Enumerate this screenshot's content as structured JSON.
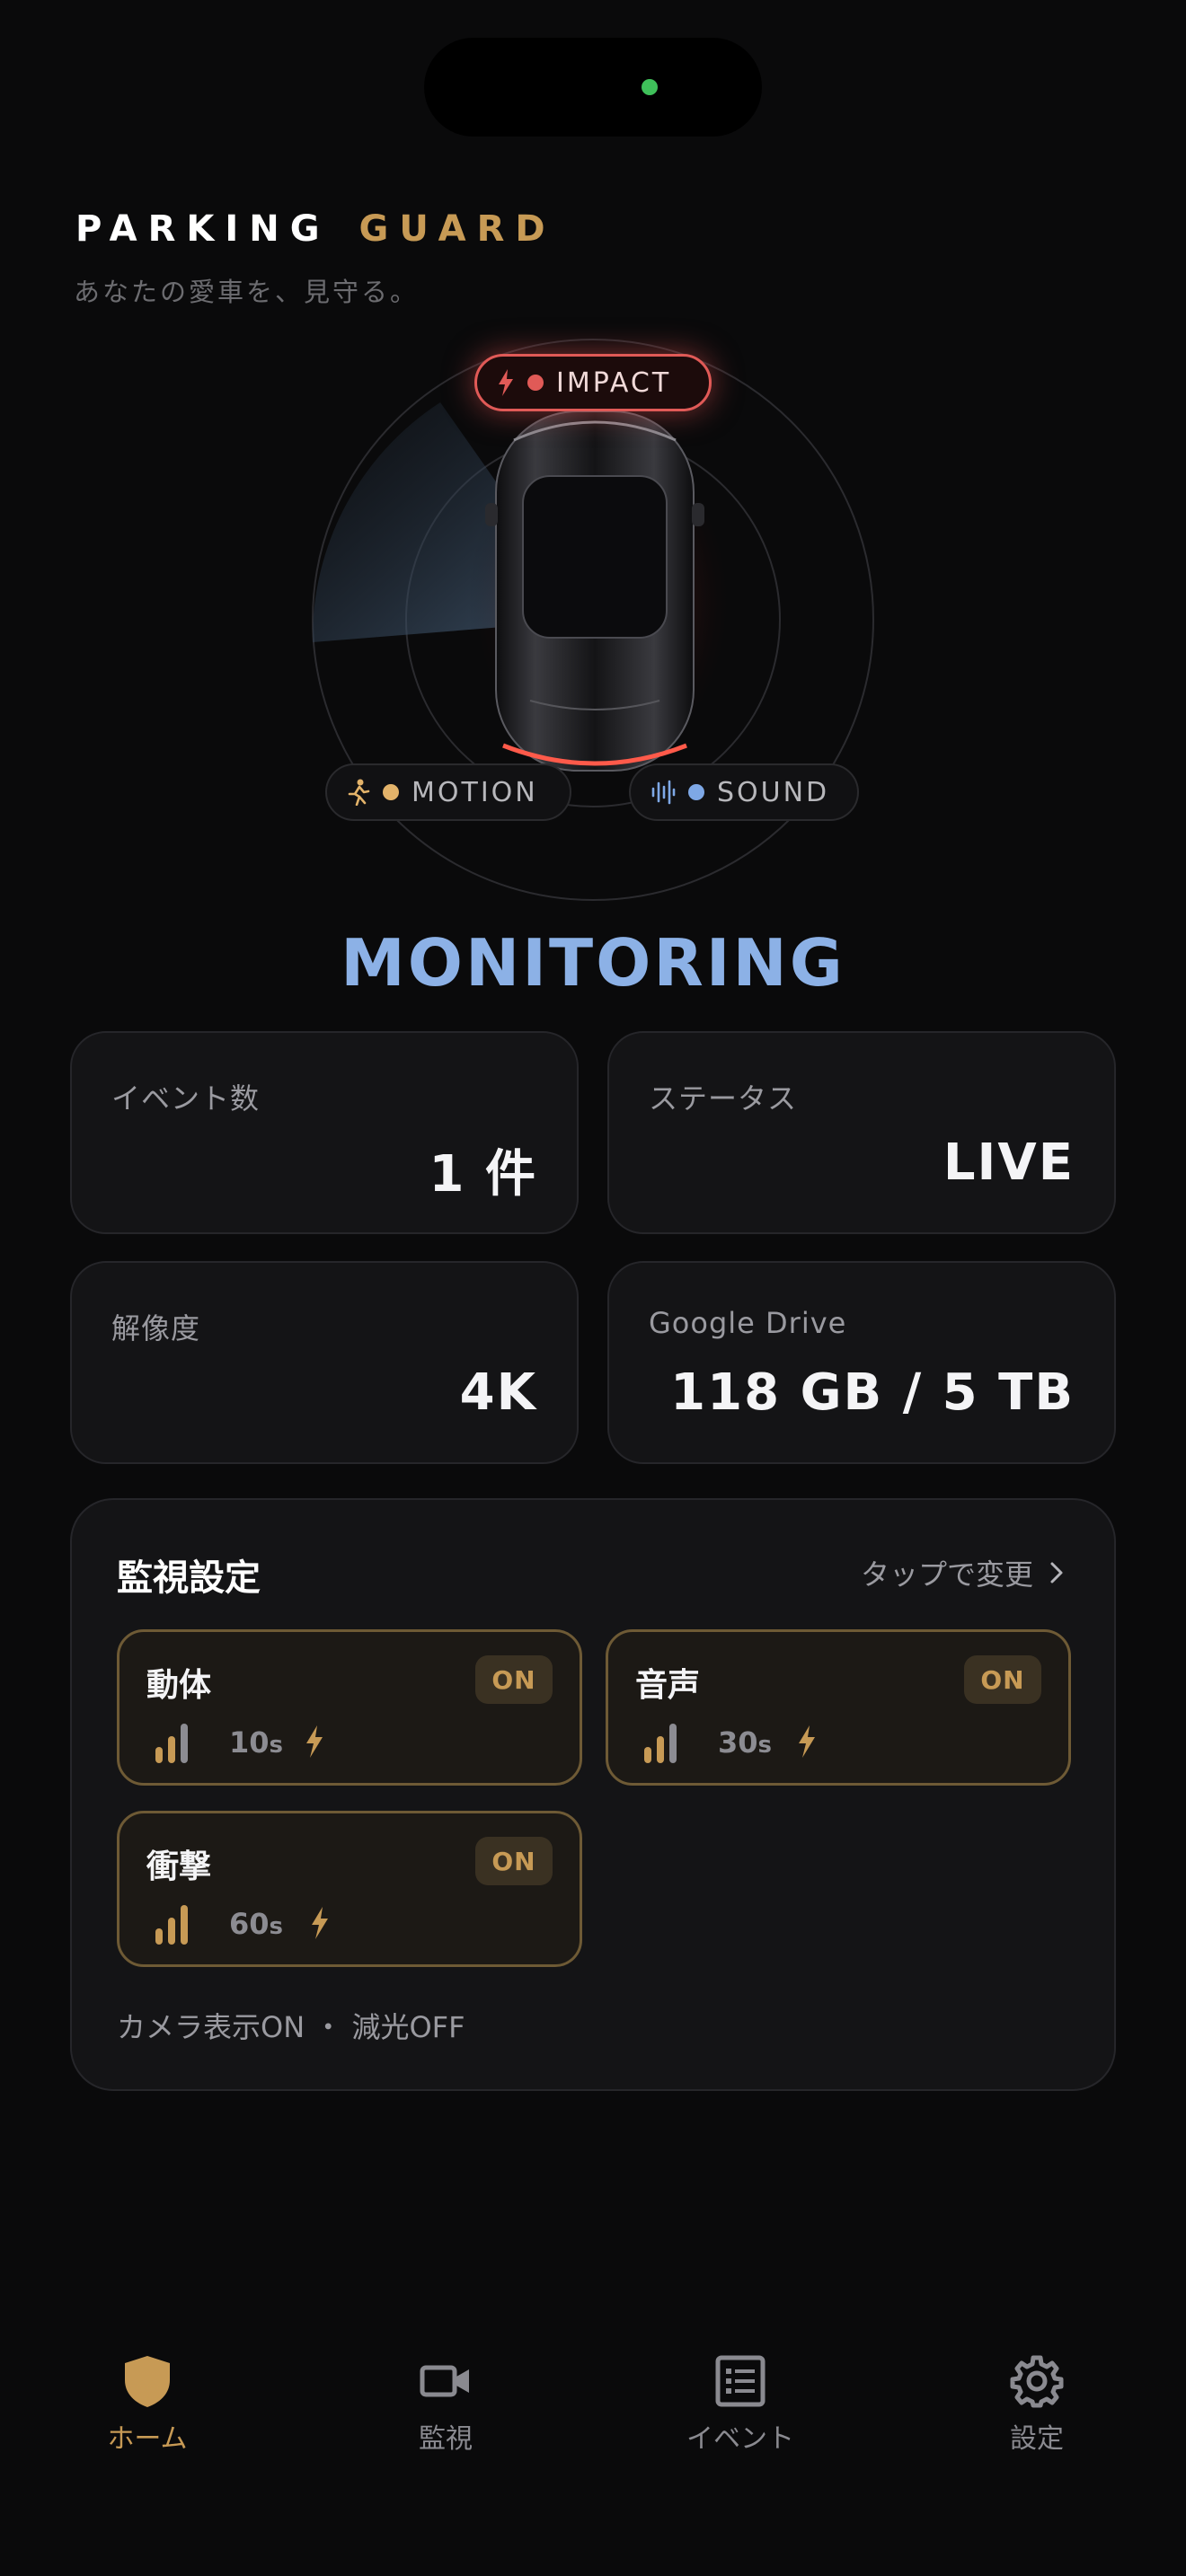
{
  "header": {
    "brand_word1": "PARKING",
    "brand_word2": "GUARD",
    "tagline": "あなたの愛車を、見守る。"
  },
  "sensors": {
    "impact": {
      "label": "IMPACT",
      "color": "#e05a57",
      "icon": "lightning-icon"
    },
    "motion": {
      "label": "MOTION",
      "color": "#e3b36a",
      "icon": "running-person-icon"
    },
    "sound": {
      "label": "SOUND",
      "color": "#7ea8e6",
      "icon": "sound-wave-icon"
    }
  },
  "status": {
    "title": "MONITORING",
    "color": "#8cb1e6"
  },
  "stats": [
    {
      "label": "イベント数",
      "value": "1 件"
    },
    {
      "label": "ステータス",
      "value": "LIVE"
    },
    {
      "label": "解像度",
      "value": "4K"
    },
    {
      "label": "Google Drive",
      "value": "118 GB / 5 TB"
    }
  ],
  "settings": {
    "title": "監視設定",
    "link": "タップで変更",
    "tiles": [
      {
        "name": "動体",
        "badge": "ON",
        "seconds": "10",
        "unit": "s"
      },
      {
        "name": "音声",
        "badge": "ON",
        "seconds": "30",
        "unit": "s"
      },
      {
        "name": "衝撃",
        "badge": "ON",
        "seconds": "60",
        "unit": "s"
      }
    ],
    "footer": "カメラ表示ON ・ 減光OFF"
  },
  "tabs": [
    {
      "label": "ホーム",
      "icon": "shield-icon",
      "active": true
    },
    {
      "label": "監視",
      "icon": "video-camera-icon",
      "active": false
    },
    {
      "label": "イベント",
      "icon": "list-icon",
      "active": false
    },
    {
      "label": "設定",
      "icon": "gear-icon",
      "active": false
    }
  ],
  "colors": {
    "accent": "#c79a55",
    "background": "#0a0a0b",
    "card": "#141416"
  }
}
